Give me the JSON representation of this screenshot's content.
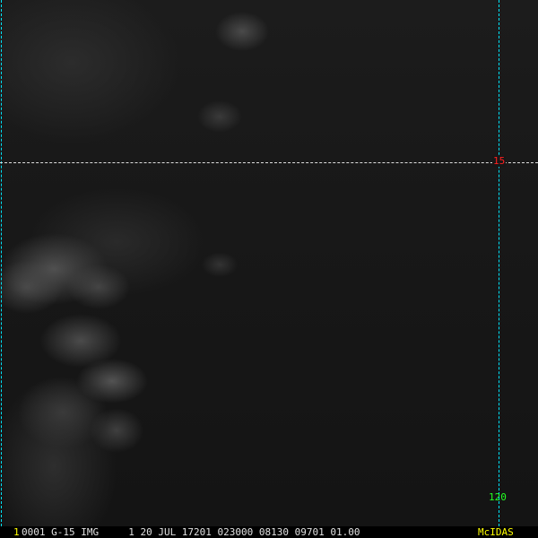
{
  "grid": {
    "latitude_label": "15",
    "longitude_label": "120",
    "latitude_color": "#ff2020",
    "longitude_color": "#22ff22",
    "line_color": "#00e5ff"
  },
  "status_bar": {
    "frame_number": "1",
    "fields": "0001 G-15 IMG     1 20 JUL 17201 023000 08130 09701 01.00",
    "brand": "McIDAS"
  }
}
